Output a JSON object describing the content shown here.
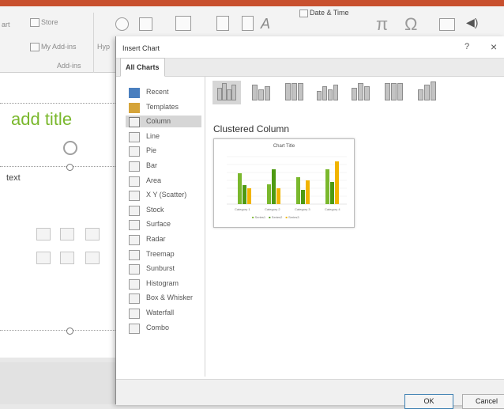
{
  "ribbon": {
    "partial_left_label": "art",
    "store_label": "Store",
    "addins_label": "My Add-ins",
    "hyperlink_partial": "Hyp",
    "group_label": "Add-ins",
    "date_time_label": "Date & Time",
    "symbol_glyph": "π",
    "omega_glyph": "Ω",
    "audio_glyph": "◀)"
  },
  "slide": {
    "title_placeholder": "add title",
    "text_placeholder": "text"
  },
  "dialog": {
    "title": "Insert Chart",
    "help_label": "?",
    "close_label": "×",
    "tab_label": "All Charts",
    "categories": [
      {
        "label": "Recent",
        "icon": "recent-icon"
      },
      {
        "label": "Templates",
        "icon": "templates-icon"
      },
      {
        "label": "Column",
        "icon": "column-chart-icon"
      },
      {
        "label": "Line",
        "icon": "line-chart-icon"
      },
      {
        "label": "Pie",
        "icon": "pie-chart-icon"
      },
      {
        "label": "Bar",
        "icon": "bar-chart-icon"
      },
      {
        "label": "Area",
        "icon": "area-chart-icon"
      },
      {
        "label": "X Y (Scatter)",
        "icon": "scatter-chart-icon"
      },
      {
        "label": "Stock",
        "icon": "stock-chart-icon"
      },
      {
        "label": "Surface",
        "icon": "surface-chart-icon"
      },
      {
        "label": "Radar",
        "icon": "radar-chart-icon"
      },
      {
        "label": "Treemap",
        "icon": "treemap-chart-icon"
      },
      {
        "label": "Sunburst",
        "icon": "sunburst-chart-icon"
      },
      {
        "label": "Histogram",
        "icon": "histogram-chart-icon"
      },
      {
        "label": "Box & Whisker",
        "icon": "box-whisker-chart-icon"
      },
      {
        "label": "Waterfall",
        "icon": "waterfall-chart-icon"
      },
      {
        "label": "Combo",
        "icon": "combo-chart-icon"
      }
    ],
    "selected_category": "Column",
    "selected_type": "Clustered Column",
    "preview": {
      "chart_title": "Chart Title",
      "legend": [
        "Series1",
        "Series2",
        "Series3"
      ],
      "categories": [
        "Category 1",
        "Category 2",
        "Category 3",
        "Category 4"
      ]
    },
    "ok_label": "OK",
    "cancel_label": "Cancel"
  },
  "colors": {
    "accent_green": "#7ab82d",
    "series1": "#7ab82d",
    "series2": "#4e9a12",
    "series3": "#f1b400",
    "ribbon_top": "#c8502e"
  }
}
